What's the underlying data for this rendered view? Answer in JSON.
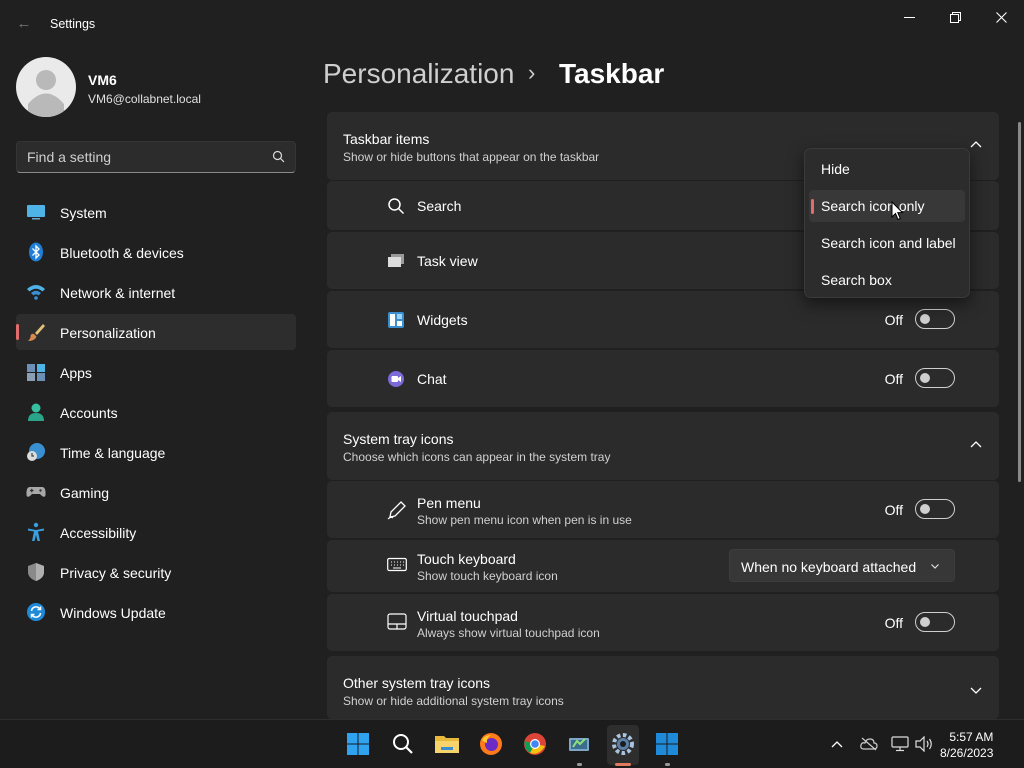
{
  "window": {
    "title": "Settings",
    "back_label": "←"
  },
  "profile": {
    "name": "VM6",
    "email": "VM6@collabnet.local"
  },
  "search": {
    "placeholder": "Find a setting"
  },
  "nav": {
    "items": [
      {
        "label": "System",
        "icon": "monitor-icon"
      },
      {
        "label": "Bluetooth & devices",
        "icon": "bluetooth-icon"
      },
      {
        "label": "Network & internet",
        "icon": "wifi-icon"
      },
      {
        "label": "Personalization",
        "icon": "brush-icon",
        "active": true
      },
      {
        "label": "Apps",
        "icon": "apps-icon"
      },
      {
        "label": "Accounts",
        "icon": "person-icon"
      },
      {
        "label": "Time & language",
        "icon": "globe-clock-icon"
      },
      {
        "label": "Gaming",
        "icon": "gamepad-icon"
      },
      {
        "label": "Accessibility",
        "icon": "accessibility-icon"
      },
      {
        "label": "Privacy & security",
        "icon": "shield-icon"
      },
      {
        "label": "Windows Update",
        "icon": "update-icon"
      }
    ]
  },
  "breadcrumb": {
    "parent": "Personalization",
    "separator": "›",
    "current": "Taskbar"
  },
  "taskbar_items": {
    "title": "Taskbar items",
    "subtitle": "Show or hide buttons that appear on the taskbar",
    "rows": [
      {
        "label": "Search",
        "icon": "search-icon"
      },
      {
        "label": "Task view",
        "icon": "task-view-icon"
      },
      {
        "label": "Widgets",
        "icon": "widgets-icon",
        "state": "Off"
      },
      {
        "label": "Chat",
        "icon": "chat-icon",
        "state": "Off"
      }
    ]
  },
  "search_popup": {
    "options": [
      "Hide",
      "Search icon only",
      "Search icon and label",
      "Search box"
    ],
    "selected": "Search icon only"
  },
  "system_tray": {
    "title": "System tray icons",
    "subtitle": "Choose which icons can appear in the system tray",
    "pen": {
      "label": "Pen menu",
      "sub": "Show pen menu icon when pen is in use",
      "state": "Off"
    },
    "keyboard": {
      "label": "Touch keyboard",
      "sub": "Show touch keyboard icon",
      "value": "When no keyboard attached"
    },
    "touchpad": {
      "label": "Virtual touchpad",
      "sub": "Always show virtual touchpad icon",
      "state": "Off"
    }
  },
  "other_tray": {
    "title": "Other system tray icons",
    "subtitle": "Show or hide additional system tray icons"
  },
  "taskbar": {
    "time": "5:57 AM",
    "date": "8/26/2023"
  },
  "colors": {
    "accent": "#e06c6c",
    "background": "#202020",
    "card": "#2b2b2b"
  }
}
